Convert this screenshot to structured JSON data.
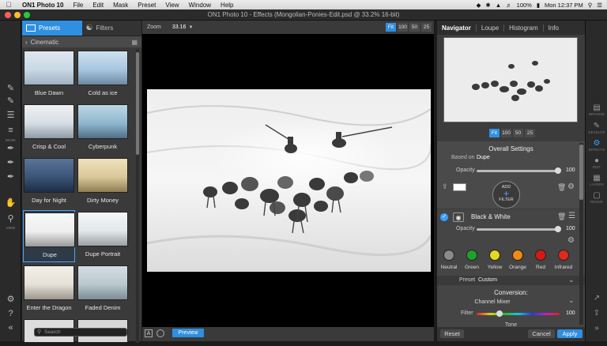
{
  "menubar": {
    "app_name": "ON1 Photo 10",
    "items": [
      "File",
      "Edit",
      "Mask",
      "Preset",
      "View",
      "Window",
      "Help"
    ],
    "battery": "100%",
    "time": "Mon 12:37 PM"
  },
  "window": {
    "title": "ON1 Photo 10 - Effects (Mongolian-Ponies-Edit.psd @ 33.2% 16-bit)"
  },
  "left_tools": {
    "labels": [
      "MASK",
      "VIEW"
    ]
  },
  "browser": {
    "tabs": [
      {
        "label": "Presets"
      },
      {
        "label": "Filters"
      }
    ],
    "category": "Cinematic",
    "presets": [
      {
        "label": "Blue Dawn",
        "tint": "#c9d8e6"
      },
      {
        "label": "Cold as ice",
        "tint": "#a9c6e0"
      },
      {
        "label": "Crisp & Cool",
        "tint": "#d6dde4"
      },
      {
        "label": "Cyberpunk",
        "tint": "#8fb7cf"
      },
      {
        "label": "Day for Night",
        "tint": "#3b5578"
      },
      {
        "label": "Dirty Money",
        "tint": "#d9c89a"
      },
      {
        "label": "Dupe",
        "tint": "#eeeeee"
      },
      {
        "label": "Dupe Portrait",
        "tint": "#e4e8ea"
      },
      {
        "label": "Enter the Dragon",
        "tint": "#e6e1d8"
      },
      {
        "label": "Faded Denim",
        "tint": "#b9c8cf"
      }
    ],
    "search_placeholder": "Search"
  },
  "canvas": {
    "zoom_label": "Zoom",
    "zoom_value": "33.16",
    "zoom_buttons": [
      "Fit",
      "100",
      "50",
      "25"
    ],
    "preview_label": "Preview"
  },
  "navigator": {
    "tabs": [
      "Navigator",
      "Loupe",
      "Histogram",
      "Info"
    ],
    "zoom_buttons": [
      "Fit",
      "100",
      "50",
      "25"
    ]
  },
  "overall": {
    "title": "Overall Settings",
    "based_on_label": "Based on",
    "based_on_value": "Dupe",
    "opacity_label": "Opacity",
    "opacity_value": "100",
    "add_filter": {
      "line1": "ADD",
      "line2": "FILTER"
    }
  },
  "bw_filter": {
    "name": "Black & White",
    "opacity_label": "Opacity",
    "opacity_value": "100",
    "colors": [
      {
        "label": "Neutral",
        "color": "#8a8a8a"
      },
      {
        "label": "Green",
        "color": "#1fa22a"
      },
      {
        "label": "Yellow",
        "color": "#e8d81c"
      },
      {
        "label": "Orange",
        "color": "#f08a14"
      },
      {
        "label": "Red",
        "color": "#d81818"
      },
      {
        "label": "Infrared",
        "color": "#e02a1a"
      }
    ],
    "preset_label": "Preset",
    "preset_value": "Custom",
    "conversion_label": "Conversion:",
    "conversion_value": "Channel Mixer",
    "filter_label": "Filter",
    "filter_value": "100",
    "tone_label": "Tone"
  },
  "footer": {
    "reset": "Reset",
    "cancel": "Cancel",
    "apply": "Apply"
  },
  "right_modules": [
    "BROWSE",
    "DEVELOP",
    "EFFECTS",
    "EDIT",
    "LAYERS",
    "RESIZE"
  ]
}
